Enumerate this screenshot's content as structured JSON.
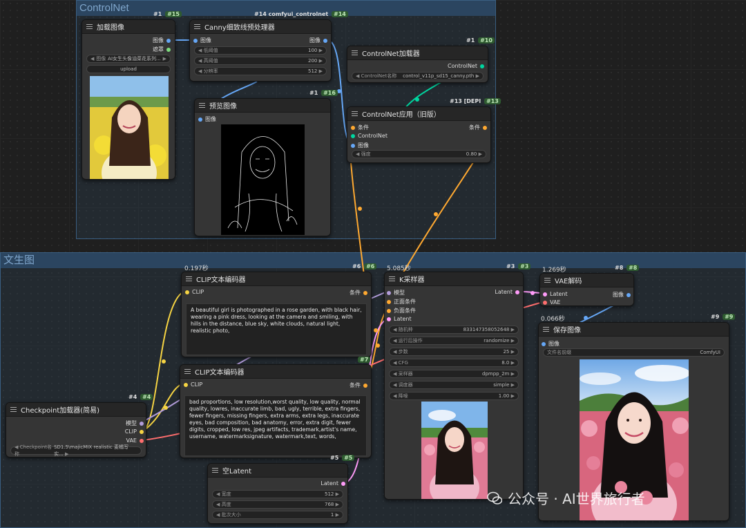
{
  "groups": {
    "controlnet": "ControlNet",
    "txt2img": "文生图"
  },
  "nodes": {
    "load_image": {
      "badge_left": "#1",
      "badge_right": "#15",
      "title": "加载图像",
      "out_image": "图像",
      "out_mask": "遮罩",
      "image_label": "图像",
      "image_value": "AI女生头像油菜花系列...",
      "upload": "upload"
    },
    "canny": {
      "badge_left": "#14 comfyui_controlnet",
      "badge_right": "#14",
      "title": "Canny细致线预处理器",
      "in_image": "图像",
      "out_image": "图像",
      "w_low_label": "低阈值",
      "w_low": "100",
      "w_high_label": "高阈值",
      "w_high": "200",
      "w_res_label": "分辨率",
      "w_res": "512"
    },
    "preview": {
      "badge_left": "#1",
      "badge_right": "#16",
      "title": "预览图像",
      "in_image": "图像"
    },
    "cn_loader": {
      "badge_left": "#1",
      "badge_right": "#10",
      "title": "ControlNet加载器",
      "out_cn": "ControlNet",
      "w_name_label": "ControlNet名称",
      "w_name": "control_v11p_sd15_canny.pth"
    },
    "cn_apply": {
      "badge_left": "#13 [DEPI",
      "badge_right": "#13",
      "title": "ControlNet应用（旧版）",
      "in_cond": "条件",
      "in_cn": "ControlNet",
      "in_image": "图像",
      "out_cond": "条件",
      "w_strength_label": "强度",
      "w_strength": "0.80"
    },
    "clip_pos": {
      "time": "0.197秒",
      "badge_left": "#6",
      "badge_right": "#6",
      "title": "CLIP文本编码器",
      "in_clip": "CLIP",
      "out_cond": "条件",
      "text": "A beautiful girl is photographed in a rose garden, with black hair, wearing a pink dress, looking at the camera and smiling, with hills in the distance, blue sky, white clouds, natural light, realistic photo,"
    },
    "clip_neg": {
      "badge_left": "",
      "badge_right": "#7",
      "title": "CLIP文本编码器",
      "in_clip": "CLIP",
      "out_cond": "条件",
      "text": "bad proportions, low resolution,worst quality, low quality, normal quality, lowres,  inaccurate limb, bad, ugly, terrible,  extra fingers, fewer fingers, missing fingers, extra arms, extra legs, inaccurate eyes, bad composition, bad anatomy, error, extra digit, fewer digits, cropped, low res, jpeg artifacts, trademark,artist's name, username, watermarksignature, watermark,text, words,"
    },
    "ksampler": {
      "time": "5.085秒",
      "badge_left": "#3",
      "badge_right": "#3",
      "title": "K采样器",
      "in_model": "模型",
      "in_pos": "正面条件",
      "in_neg": "负面条件",
      "in_latent": "Latent",
      "out_latent": "Latent",
      "w_seed_label": "随机种",
      "w_seed": "833147358052648",
      "w_ctrl_label": "运行后操作",
      "w_ctrl": "randomize",
      "w_steps_label": "步数",
      "w_steps": "25",
      "w_cfg_label": "CFG",
      "w_cfg": "8.0",
      "w_sampler_label": "采样器",
      "w_sampler": "dpmpp_2m",
      "w_sched_label": "调度器",
      "w_sched": "simple",
      "w_denoise_label": "降噪",
      "w_denoise": "1.00"
    },
    "vae_decode": {
      "time": "1.269秒",
      "badge_left": "#8",
      "badge_right": "#8",
      "title": "VAE解码",
      "in_latent": "Latent",
      "in_vae": "VAE",
      "out_image": "图像"
    },
    "save_image": {
      "time": "0.066秒",
      "badge_left": "#9",
      "badge_right": "#9",
      "title": "保存图像",
      "in_image": "图像",
      "w_prefix_label": "文件名前缀",
      "w_prefix": "ComfyUI"
    },
    "checkpoint": {
      "badge_left": "#4",
      "badge_right": "#4",
      "title": "Checkpoint加载器(简易)",
      "out_model": "模型",
      "out_clip": "CLIP",
      "out_vae": "VAE",
      "w_ckpt_label": "Checkpoint名称",
      "w_ckpt": "SD1.5\\majicMIX realistic 麦橘写实..."
    },
    "empty_latent": {
      "badge_left": "#5",
      "badge_right": "#5",
      "title": "空Latent",
      "out_latent": "Latent",
      "w_w_label": "宽度",
      "w_w": "512",
      "w_h_label": "高度",
      "w_h": "768",
      "w_b_label": "批次大小",
      "w_b": "1"
    }
  },
  "watermark": "公众号 · AI世界旅行者",
  "colors": {
    "image": "#66a7f6",
    "clip": "#f6d443",
    "model": "#b39ddb",
    "vae": "#ff6e6e",
    "conditioning": "#ffa931",
    "latent": "#ff9cf9",
    "controlnet": "#00d6a0"
  }
}
